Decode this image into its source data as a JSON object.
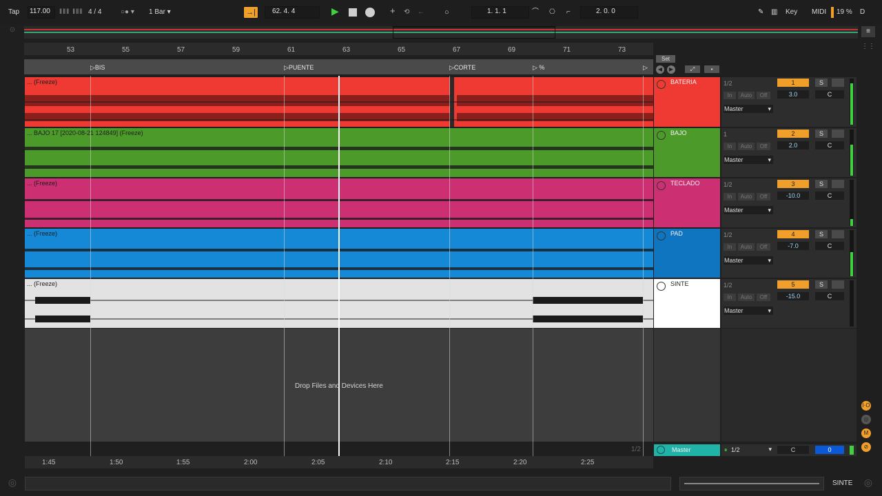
{
  "transport": {
    "tap": "Tap",
    "tempo": "117.00",
    "signature": "4 / 4",
    "quantize": "1 Bar",
    "position": "62.  4.  4",
    "loop_start": "1.  1.  1",
    "loop_length": "2.  0.  0",
    "key": "Key",
    "midi": "MIDI",
    "cpu": "19 %",
    "d": "D"
  },
  "ruler": {
    "bars": [
      "53",
      "55",
      "57",
      "59",
      "61",
      "63",
      "65",
      "67",
      "69",
      "71",
      "73"
    ],
    "set_label": "Set"
  },
  "locators": [
    "BIS",
    "PUENTE",
    "CORTE",
    "%"
  ],
  "tracks": [
    {
      "name": "BATERIA",
      "clip_label": "... (Freeze)",
      "color": "#ee3a33",
      "number": "1",
      "volume": "3.0",
      "pan": "C",
      "routing": "Master",
      "input": "1/2"
    },
    {
      "name": "BAJO",
      "clip_label": "... BAJO 17 [2020-08-21 124849] (Freeze)",
      "color": "#4c9a2a",
      "number": "2",
      "volume": "2.0",
      "pan": "C",
      "routing": "Master",
      "input": "1"
    },
    {
      "name": "TECLADO",
      "clip_label": "... (Freeze)",
      "color": "#cc2f72",
      "number": "3",
      "volume": "-10.0",
      "pan": "C",
      "routing": "Master",
      "input": "1/2"
    },
    {
      "name": "PAD",
      "clip_label": "... (Freeze)",
      "color": "#1589d6",
      "number": "4",
      "volume": "-7.0",
      "pan": "C",
      "routing": "Master",
      "input": "1/2"
    },
    {
      "name": "SINTE",
      "clip_label": "... (Freeze)",
      "color": "#e2e2e2",
      "number": "5",
      "volume": "-15.0",
      "pan": "C",
      "routing": "Master",
      "input": "1/2"
    }
  ],
  "mixer_buttons": {
    "in": "In",
    "auto": "Auto",
    "off": "Off",
    "solo": "S"
  },
  "drop_text": "Drop Files and Devices Here",
  "drop_page": "1/2",
  "master": {
    "name": "Master",
    "input": "1/2",
    "pan": "C",
    "volume": "0"
  },
  "times": [
    "1:45",
    "1:50",
    "1:55",
    "2:00",
    "2:05",
    "2:10",
    "2:15",
    "2:20",
    "2:25"
  ],
  "status": {
    "selected_track": "SINTE"
  }
}
